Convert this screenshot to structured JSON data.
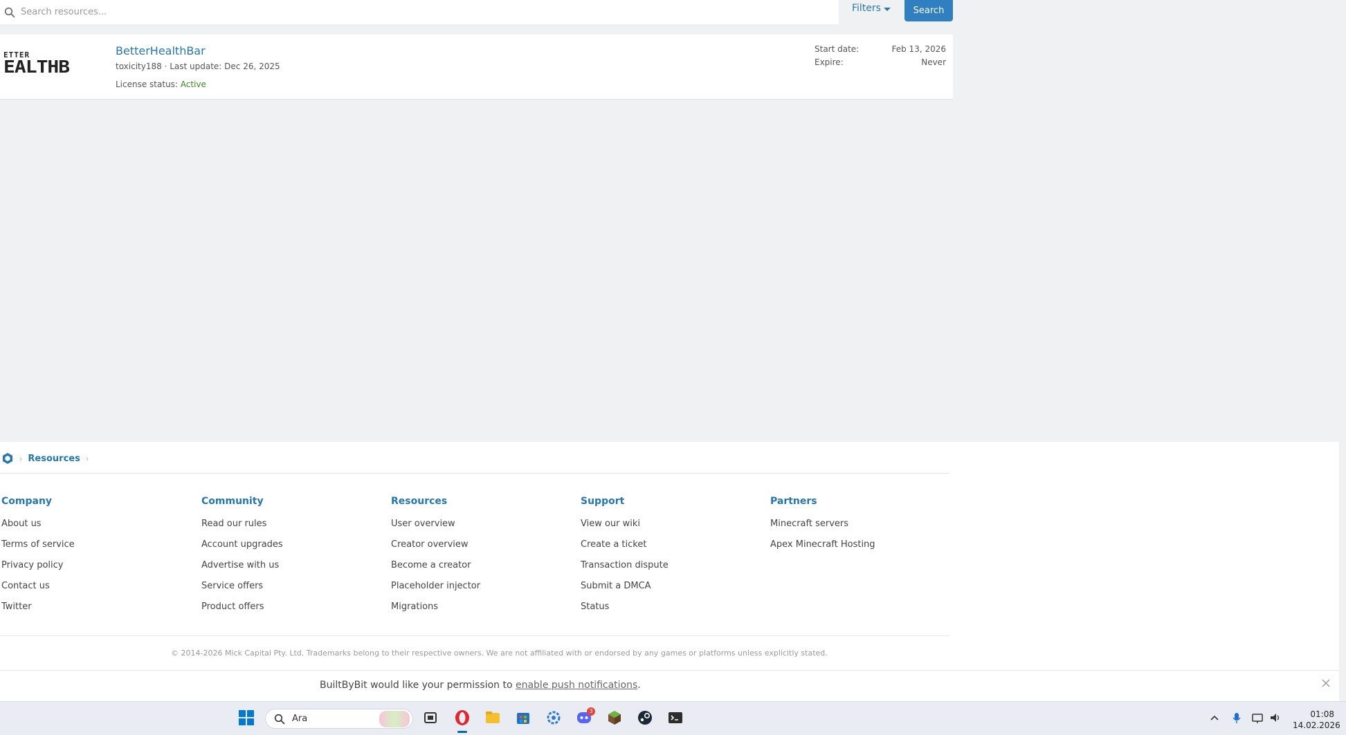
{
  "search": {
    "placeholder": "Search resources...",
    "filters_label": "Filters",
    "search_label": "Search"
  },
  "resource": {
    "logo_small": "ETTER",
    "logo_big": "EALTHB",
    "title": "BetterHealthBar",
    "author": "toxicity188",
    "meta_sep": " · ",
    "last_update_label": "Last update: ",
    "last_update": "Dec 26, 2025",
    "license_label": "License status: ",
    "license_status": "Active",
    "start_label": "Start date:",
    "start_value": "Feb 13, 2026",
    "expire_label": "Expire:",
    "expire_value": "Never"
  },
  "breadcrumb": {
    "sep": "›",
    "items": [
      "Resources"
    ]
  },
  "footer": {
    "columns": [
      {
        "heading": "Company",
        "items": [
          "About us",
          "Terms of service",
          "Privacy policy",
          "Contact us",
          "Twitter"
        ]
      },
      {
        "heading": "Community",
        "items": [
          "Read our rules",
          "Account upgrades",
          "Advertise with us",
          "Service offers",
          "Product offers"
        ]
      },
      {
        "heading": "Resources",
        "items": [
          "User overview",
          "Creator overview",
          "Become a creator",
          "Placeholder injector",
          "Migrations"
        ]
      },
      {
        "heading": "Support",
        "items": [
          "View our wiki",
          "Create a ticket",
          "Transaction dispute",
          "Submit a DMCA",
          "Status"
        ]
      },
      {
        "heading": "Partners",
        "items": [
          "Minecraft servers",
          "Apex Minecraft Hosting"
        ]
      }
    ],
    "copyright": "© 2014-2026 Mick Capital Pty. Ltd. Trademarks belong to their respective owners. We are not affiliated with or endorsed by any games or platforms unless explicitly stated."
  },
  "notice": {
    "prefix": "BuiltByBit would like your permission to ",
    "link": "enable push notifications",
    "suffix": "."
  },
  "taskbar": {
    "search_text": "Ara",
    "discord_badge": "3",
    "time": "01:08",
    "date": "14.02.2026"
  },
  "colors": {
    "accent": "#2577b1",
    "button": "#2f7fc1",
    "active_status": "#3a8a1e"
  }
}
